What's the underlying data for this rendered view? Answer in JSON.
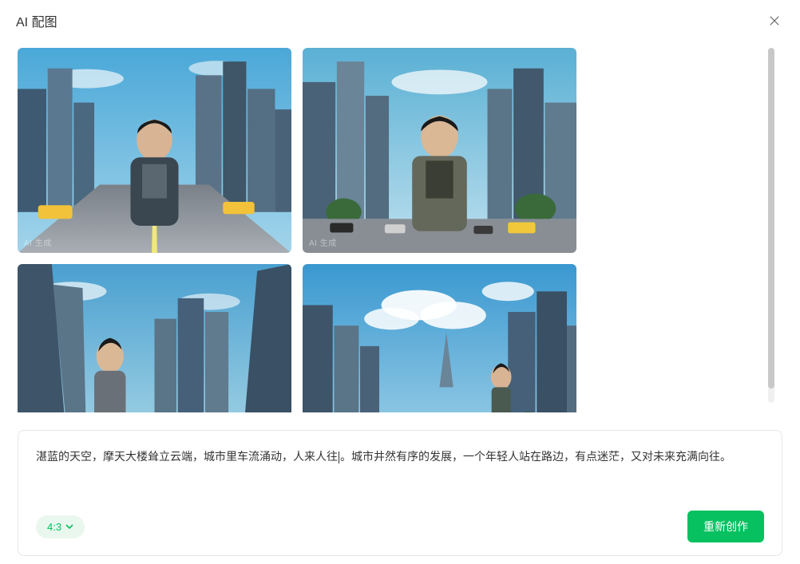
{
  "header": {
    "title": "AI 配图"
  },
  "images": {
    "watermark": "AI 生成"
  },
  "prompt": {
    "text_before_cursor": "湛蓝的天空，摩天大楼耸立云端，城市里车流涌动，人来人往",
    "text_after_cursor": "。城市井然有序的发展，一个年轻人站在路边，有点迷茫，又对未来充满向往。"
  },
  "controls": {
    "ratio_label": "4:3",
    "regenerate_label": "重新创作"
  },
  "colors": {
    "accent": "#07c160"
  }
}
